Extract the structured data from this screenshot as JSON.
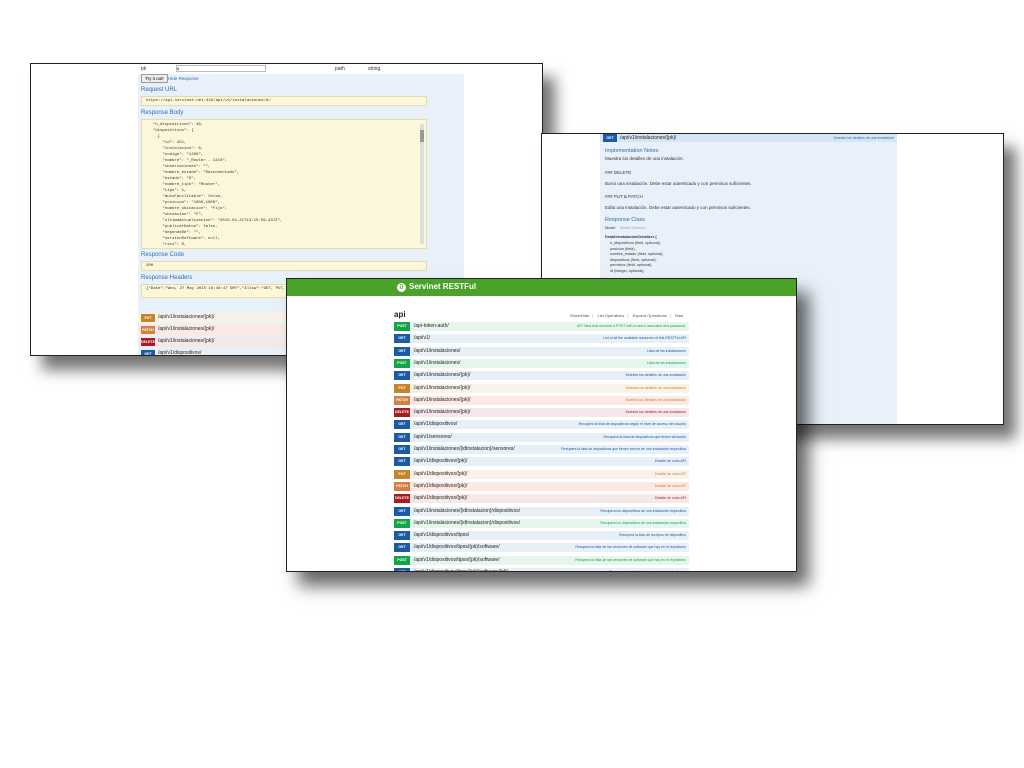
{
  "win1": {
    "param_name": "pk",
    "param_value": "6",
    "param_type": "path",
    "param_datatype": "string",
    "try_button": "Try it out!",
    "hide_link": "Hide Response",
    "request_url_label": "Request URL",
    "request_url": "https://api-servinet.net:443/api/v1/instalaciones/6/",
    "response_body_label": "Response Body",
    "response_body_lines": [
      "  \"n_dispositivos\": 46,",
      "  \"dispositivos\": [",
      "    {",
      "      \"id\": 451,",
      "      \"instalacion\": 6,",
      "      \"codigo\": \"1290\",",
      "      \"nombre\": \"_Router - 1210\",",
      "      \"observaciones\": \"\",",
      "      \"nombre_estado\": \"Desconectado\",",
      "      \"estado\": \"D\",",
      "      \"nombre_tipo\": \"Router\",",
      "      \"tipo\": 1,",
      "      \"autoFacilitable\": false,",
      "      \"posicion\": \"1000,1000\",",
      "      \"nombre_ubicacion\": \"Fijo\",",
      "      \"ubicacion\": \"F\",",
      "      \"ultimaActualizacion\": \"2015-04-21T13:15:59.437Z\",",
      "      \"publicarDatos\": false,",
      "      \"dependeDe\": \"\",",
      "      \"versionSoftware\": null,",
      "      \"rssi\": 0,"
    ],
    "response_code_label": "Response Code",
    "response_code": "200",
    "response_headers_label": "Response Headers",
    "response_headers": "{\"Date\":\"Wed, 27 May 2015 16:40:47 GMT\",\"Allow\":\"GET, PUT, PATCH",
    "endpoints": [
      {
        "method": "PUT",
        "path": "/api/v1/instalaciones/{pk}/"
      },
      {
        "method": "PATCH",
        "path": "/api/v1/instalaciones/{pk}/"
      },
      {
        "method": "DELETE",
        "path": "/api/v1/instalaciones/{pk}/"
      },
      {
        "method": "GET",
        "path": "/api/v1/dispositivos/"
      }
    ]
  },
  "win2": {
    "header_method": "GET",
    "header_path": "/api/v1/instalaciones/{pk}/",
    "header_desc": "Muestra los detalles de una instalación",
    "impl_label": "Implementation Notes",
    "impl_text": "Muestra los detalles de una instalación.",
    "delete_title": "### DELETE",
    "delete_text": "Borra una instalación. Debe estar autenticado y con permisos suficientes.",
    "putpatch_title": "### PUT & PATCH",
    "putpatch_text": "Edita una instalación. Debe estar autenticado y con permisos suficientes.",
    "response_class_label": "Response Class",
    "model_tab": "Model",
    "model_schema_tab": "Model Schema",
    "serializer_name": "DetalleInstalacionSerializer {",
    "fields": [
      "n_dispositivos (field, optional),",
      "posicion (field),",
      "nombre_estado (field, optional),",
      "dispositivos (field, optional),",
      "permisos (field, optional),",
      "id (integer, optional),"
    ]
  },
  "win3": {
    "logo": "{}",
    "title": "Servinet RESTFul",
    "api_label": "api",
    "actions": [
      "Show/Hide",
      "List Operations",
      "Expand Operations",
      "Raw"
    ],
    "rows": [
      {
        "method": "POST",
        "path": "/api-token-auth/",
        "desc": "API View that receives a POST with a user's username and password."
      },
      {
        "method": "GET",
        "path": "/api/v1/",
        "desc": "List of all the available resources of this RESTFul API"
      },
      {
        "method": "GET",
        "path": "/api/v1/instalaciones/",
        "desc": "Lista de las instalaciones"
      },
      {
        "method": "POST",
        "path": "/api/v1/instalaciones/",
        "desc": "Lista de las instalaciones"
      },
      {
        "method": "GET",
        "path": "/api/v1/instalaciones/{pk}/",
        "desc": "Muestra los detalles de una instalación"
      },
      {
        "method": "PUT",
        "path": "/api/v1/instalaciones/{pk}/",
        "desc": "Muestra los detalles de una instalación"
      },
      {
        "method": "PATCH",
        "path": "/api/v1/instalaciones/{pk}/",
        "desc": "Muestra los detalles de una instalación"
      },
      {
        "method": "DELETE",
        "path": "/api/v1/instalaciones/{pk}/",
        "desc": "Muestra los detalles de una instalación"
      },
      {
        "method": "GET",
        "path": "/api/v1/dispositivos/",
        "desc": "Recupera la lista de dispositivos según el nivel de acceso del usuario"
      },
      {
        "method": "GET",
        "path": "/api/v1/sensores/",
        "desc": "Recupera la lista de dispositivos que tienen sensores"
      },
      {
        "method": "GET",
        "path": "/api/v1/instalaciones/{idInstalacion}/sensores/",
        "desc": "Recupera la lista de dispositivos que tienen sensor de una instalación específica"
      },
      {
        "method": "GET",
        "path": "/api/v1/dispositivos/{pk}/",
        "desc": "Detalle de nodo API"
      },
      {
        "method": "PUT",
        "path": "/api/v1/dispositivos/{pk}/",
        "desc": "Detalle de nodo API"
      },
      {
        "method": "PATCH",
        "path": "/api/v1/dispositivos/{pk}/",
        "desc": "Detalle de nodo API"
      },
      {
        "method": "DELETE",
        "path": "/api/v1/dispositivos/{pk}/",
        "desc": "Detalle de nodo API"
      },
      {
        "method": "GET",
        "path": "/api/v1/instalaciones/{idInstalacion}/dispositivos/",
        "desc": "Recupera los dispositivos de una instalación específica"
      },
      {
        "method": "POST",
        "path": "/api/v1/instalaciones/{idInstalacion}/dispositivos/",
        "desc": "Recupera los dispositivos de una instalación específica"
      },
      {
        "method": "GET",
        "path": "/api/v1/dispositivos/tipos/",
        "desc": "Recupera la lista de los tipos de dispositivo"
      },
      {
        "method": "GET",
        "path": "/api/v1/dispositivos/tipos/{pk}/software/",
        "desc": "Recupera la lista de las versiones de software que hay en el repositorio"
      },
      {
        "method": "POST",
        "path": "/api/v1/dispositivos/tipos/{pk}/software/",
        "desc": "Recupera la lista de las versiones de software que hay en el repositorio"
      },
      {
        "method": "GET",
        "path": "/api/v1/dispositivos/tipos/{pk}/software/{id}/",
        "desc": "Recupera los detalles de una versión de software"
      }
    ]
  },
  "colors": {
    "header_green": "#4aa22a",
    "get": "#1b5aa5",
    "post": "#10a54a",
    "put": "#c5862b",
    "patch": "#d38042",
    "delete": "#a41e22",
    "panel_bg": "#e8f1fa",
    "code_bg": "#fcf6db"
  }
}
